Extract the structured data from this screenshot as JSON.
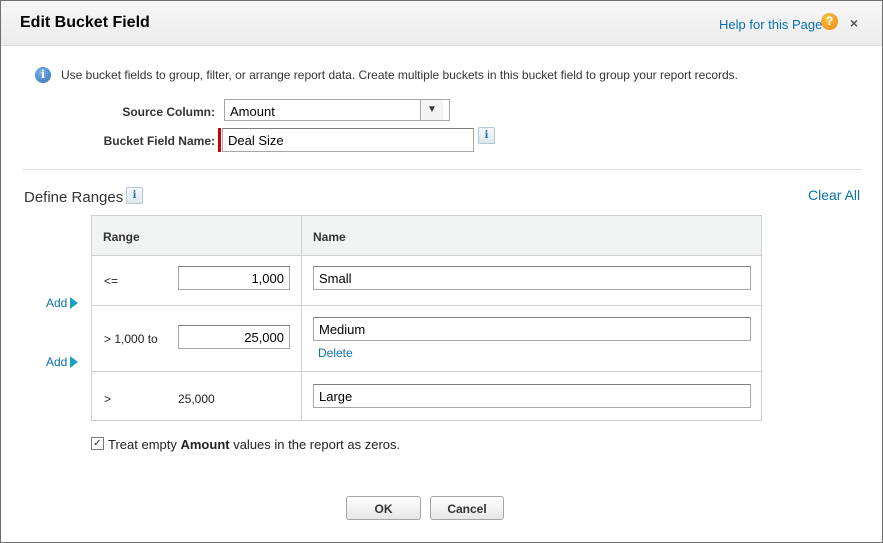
{
  "dialog": {
    "title": "Edit Bucket Field",
    "help_link": "Help for this Page",
    "help_icon": "?",
    "close_icon": "×"
  },
  "info": {
    "icon": "i",
    "text": "Use bucket fields to group, filter, or arrange report data. Create multiple buckets in this bucket field to group your report records."
  },
  "form": {
    "source_column_label": "Source Column:",
    "source_column_value": "Amount",
    "bucket_field_name_label": "Bucket Field Name:",
    "bucket_field_name_value": "Deal Size",
    "info_glyph": "i"
  },
  "ranges": {
    "section_title": "Define Ranges",
    "clear_all": "Clear All",
    "headers": {
      "range": "Range",
      "name": "Name"
    },
    "rows": [
      {
        "operator": "<=",
        "value": "1,000",
        "name": "Small"
      },
      {
        "operator": "> 1,000 to",
        "value": "25,000",
        "name": "Medium",
        "delete": "Delete"
      },
      {
        "operator": ">",
        "value": "25,000",
        "name": "Large"
      }
    ],
    "add_label": "Add"
  },
  "option": {
    "checked": true,
    "check_glyph": "✓",
    "text_before": "Treat empty ",
    "text_bold": "Amount",
    "text_after": " values in the report as zeros."
  },
  "buttons": {
    "ok": "OK",
    "cancel": "Cancel"
  },
  "colors": {
    "link": "#0a6fad",
    "required": "#cc0000",
    "add_arrow": "#1aa3c0"
  }
}
